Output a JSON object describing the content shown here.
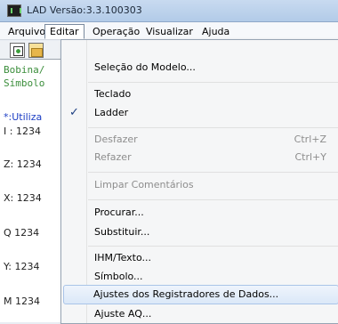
{
  "window": {
    "title": "LAD Versão:3.3.100303",
    "icon": "ladder-app-icon"
  },
  "menubar": {
    "items": [
      "Arquivo",
      "Editar",
      "Operação",
      "Visualizar",
      "Ajuda"
    ],
    "active": "Editar"
  },
  "toolbar": {
    "icons": [
      "new-diagram-icon",
      "open-folder-icon"
    ]
  },
  "pane": {
    "lines": [
      "Bobina/",
      "Símbolo",
      "*:Utiliza",
      "I : 1234",
      "Z: 1234",
      "X: 1234",
      "Q 1234",
      "Y: 1234",
      "M 1234"
    ]
  },
  "dropdown": {
    "items": [
      {
        "label": "Seleção do Modelo...",
        "shortcut": "",
        "state": "normal"
      },
      {
        "label": "Teclado",
        "shortcut": "",
        "state": "normal"
      },
      {
        "label": "Ladder",
        "shortcut": "",
        "state": "checked"
      },
      {
        "label": "Desfazer",
        "shortcut": "Ctrl+Z",
        "state": "disabled"
      },
      {
        "label": "Refazer",
        "shortcut": "Ctrl+Y",
        "state": "disabled"
      },
      {
        "label": "Limpar Comentários",
        "shortcut": "",
        "state": "disabled"
      },
      {
        "label": "Procurar...",
        "shortcut": "",
        "state": "normal"
      },
      {
        "label": "Substituir...",
        "shortcut": "",
        "state": "normal"
      },
      {
        "label": "IHM/Texto...",
        "shortcut": "",
        "state": "normal"
      },
      {
        "label": "Símbolo...",
        "shortcut": "",
        "state": "normal"
      },
      {
        "label": "Ajustes dos Registradores de Dados...",
        "shortcut": "",
        "state": "hover"
      },
      {
        "label": "Ajuste AQ...",
        "shortcut": "",
        "state": "normal"
      }
    ]
  }
}
